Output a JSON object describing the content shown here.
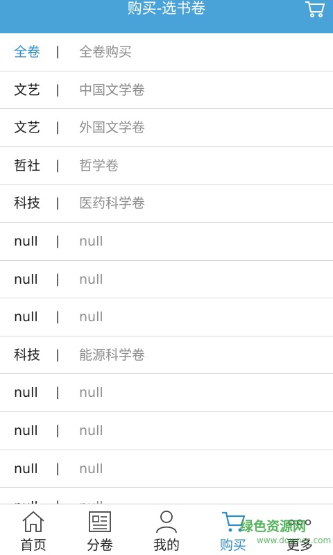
{
  "header": {
    "title": "购买-选书卷",
    "cart_icon": "cart-icon"
  },
  "colors": {
    "accent": "#4aa3d8",
    "active_text": "#2e8ec9",
    "watermark": "#3aa843"
  },
  "list": {
    "separator": "|",
    "rows": [
      {
        "category": "全卷",
        "name": "全卷购买"
      },
      {
        "category": "文艺",
        "name": "中国文学卷"
      },
      {
        "category": "文艺",
        "name": "外国文学卷"
      },
      {
        "category": "哲社",
        "name": "哲学卷"
      },
      {
        "category": "科技",
        "name": "医药科学卷"
      },
      {
        "category": "null",
        "name": "null"
      },
      {
        "category": "null",
        "name": "null"
      },
      {
        "category": "null",
        "name": "null"
      },
      {
        "category": "科技",
        "name": "能源科学卷"
      },
      {
        "category": "null",
        "name": "null"
      },
      {
        "category": "null",
        "name": "null"
      },
      {
        "category": "null",
        "name": "null"
      },
      {
        "category": "null",
        "name": "null"
      }
    ]
  },
  "tabbar": {
    "tabs": [
      {
        "label": "首页",
        "icon": "home-icon"
      },
      {
        "label": "分卷",
        "icon": "newspaper-icon"
      },
      {
        "label": "我的",
        "icon": "user-icon"
      },
      {
        "label": "购买",
        "icon": "cart-icon",
        "active": true
      },
      {
        "label": "更多",
        "icon": "more-dots-icon"
      }
    ]
  },
  "watermark": {
    "line1": "绿色资源网",
    "line2": "www.downcc.com"
  }
}
